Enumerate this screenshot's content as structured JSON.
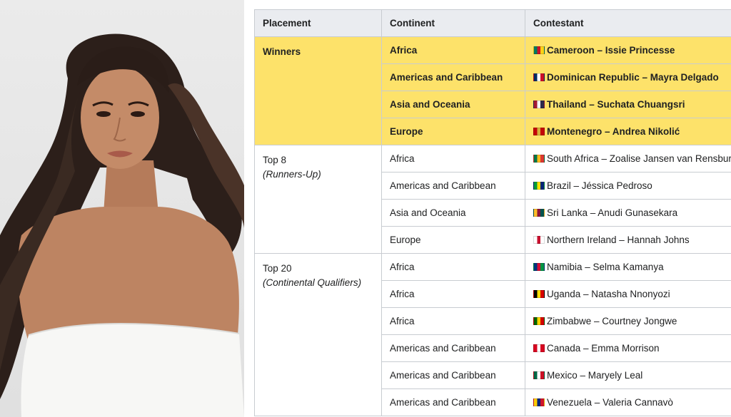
{
  "table": {
    "headers": [
      "Placement",
      "Continent",
      "Contestant"
    ],
    "groups": [
      {
        "placement": "Winners",
        "placement_sub": "",
        "highlight": true,
        "rows": [
          {
            "continent": "Africa",
            "contestant": "Cameroon – Issie Princesse",
            "flag": [
              "#007a5e",
              "#ce1126",
              "#fcd116"
            ]
          },
          {
            "continent": "Americas and Caribbean",
            "contestant": "Dominican Republic – Mayra Delgado",
            "flag": [
              "#002d62",
              "#ffffff",
              "#ce1126"
            ]
          },
          {
            "continent": "Asia and Oceania",
            "contestant": "Thailand – Suchata Chuangsri",
            "flag": [
              "#a51931",
              "#f4f5f8",
              "#2d2a4a"
            ]
          },
          {
            "continent": "Europe",
            "contestant": "Montenegro – Andrea Nikolić",
            "flag": [
              "#c40308",
              "#d4af3a",
              "#c40308"
            ]
          }
        ]
      },
      {
        "placement": "Top 8",
        "placement_sub": "(Runners-Up)",
        "highlight": false,
        "rows": [
          {
            "continent": "Africa",
            "contestant": "South Africa – Zoalise Jansen van Rensburg",
            "flag": [
              "#007749",
              "#ffb81c",
              "#de3831"
            ]
          },
          {
            "continent": "Americas and Caribbean",
            "contestant": "Brazil – Jéssica Pedroso",
            "flag": [
              "#009c3b",
              "#ffdf00",
              "#002776"
            ]
          },
          {
            "continent": "Asia and Oceania",
            "contestant": "Sri Lanka – Anudi Gunasekara",
            "flag": [
              "#ffbe29",
              "#8d153a",
              "#00534e"
            ]
          },
          {
            "continent": "Europe",
            "contestant": "Northern Ireland – Hannah Johns",
            "flag": [
              "#ffffff",
              "#c8102e",
              "#ffffff"
            ]
          }
        ]
      },
      {
        "placement": "Top 20",
        "placement_sub": "(Continental Qualifiers)",
        "highlight": false,
        "rows": [
          {
            "continent": "Africa",
            "contestant": "Namibia – Selma Kamanya",
            "flag": [
              "#003580",
              "#d21034",
              "#009543"
            ]
          },
          {
            "continent": "Africa",
            "contestant": "Uganda – Natasha Nnonyozi",
            "flag": [
              "#000000",
              "#fcdc04",
              "#d90000"
            ]
          },
          {
            "continent": "Africa",
            "contestant": "Zimbabwe – Courtney Jongwe",
            "flag": [
              "#006400",
              "#ffd200",
              "#d40000"
            ]
          },
          {
            "continent": "Americas and Caribbean",
            "contestant": "Canada – Emma Morrison",
            "flag": [
              "#d80621",
              "#ffffff",
              "#d80621"
            ]
          },
          {
            "continent": "Americas and Caribbean",
            "contestant": "Mexico – Maryely Leal",
            "flag": [
              "#006847",
              "#ffffff",
              "#ce1126"
            ]
          },
          {
            "continent": "Americas and Caribbean",
            "contestant": "Venezuela – Valeria Cannavò",
            "flag": [
              "#ffcc00",
              "#00247d",
              "#cf142b"
            ]
          }
        ]
      }
    ]
  },
  "colors": {
    "header_bg": "#eaecf0",
    "winner_bg": "#fde26a",
    "border": "#c8ccd1"
  }
}
